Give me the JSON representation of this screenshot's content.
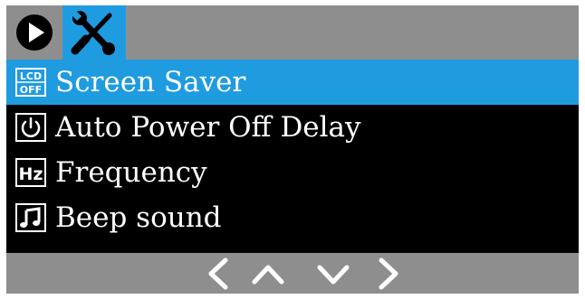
{
  "tabs": [
    {
      "id": "playback",
      "icon": "play-circle-icon",
      "active": false
    },
    {
      "id": "setup",
      "icon": "wrench-screwdriver-icon",
      "active": true
    }
  ],
  "menu": {
    "items": [
      {
        "label": "Screen Saver",
        "icon": "lcd-off-icon",
        "selected": true
      },
      {
        "label": "Auto Power Off Delay",
        "icon": "power-icon",
        "selected": false
      },
      {
        "label": "Frequency",
        "icon": "hz-icon",
        "selected": false
      },
      {
        "label": "Beep sound",
        "icon": "music-note-icon",
        "selected": false
      }
    ]
  },
  "icons": {
    "lcd_top": "LCD",
    "lcd_bottom": "OFF",
    "hz": "Hz"
  },
  "nav": [
    "chevron-left-icon",
    "chevron-up-icon",
    "chevron-down-icon",
    "chevron-right-icon"
  ],
  "colors": {
    "accent": "#1f9be0",
    "bar": "#8e8e8e",
    "background": "#000000",
    "text": "#ffffff"
  }
}
